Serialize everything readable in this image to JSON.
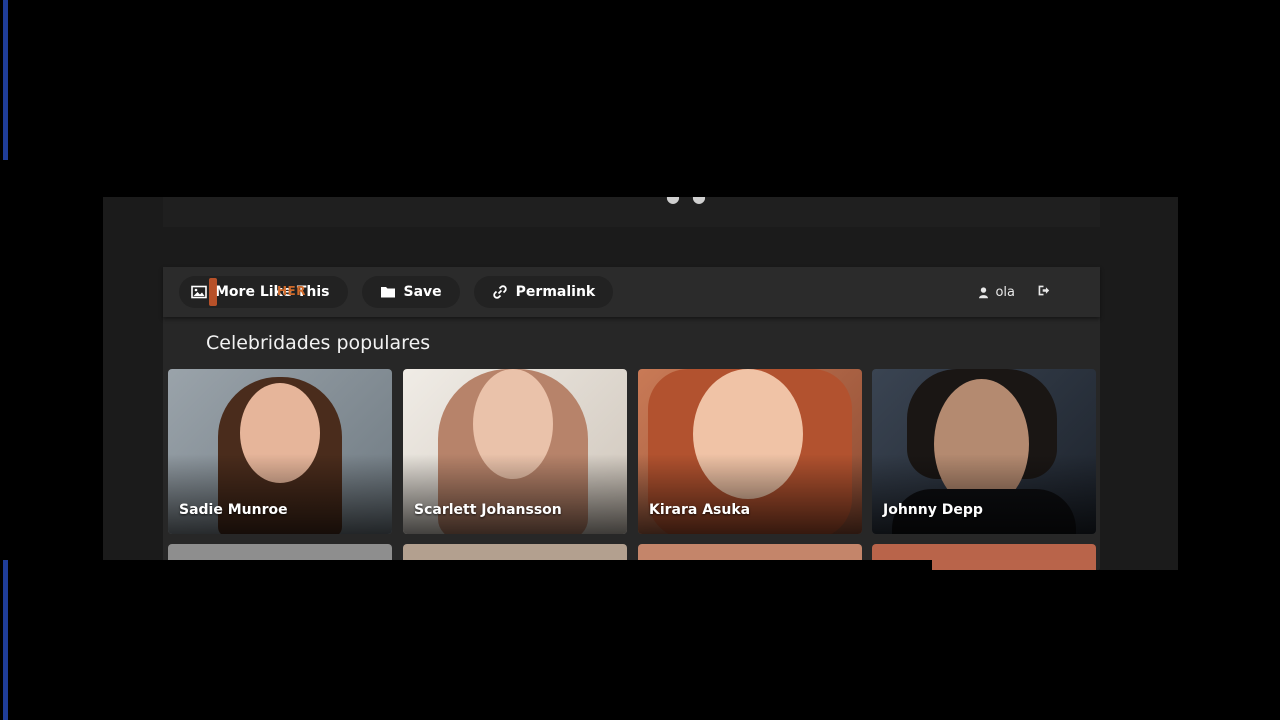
{
  "toolbar": {
    "more_like_this": "More Like This",
    "ghost_text": "HER",
    "save": "Save",
    "permalink": "Permalink",
    "user_name": "ola"
  },
  "section": {
    "title": "Celebridades populares"
  },
  "celebrities": [
    {
      "name": "Sadie Munroe"
    },
    {
      "name": "Scarlett Johansson"
    },
    {
      "name": "Kirara Asuka"
    },
    {
      "name": "Johnny Depp"
    }
  ],
  "icons": {
    "more_like_this": "image-icon",
    "save": "folder-icon",
    "permalink": "link-icon",
    "user": "user-icon",
    "logout": "logout-icon"
  }
}
